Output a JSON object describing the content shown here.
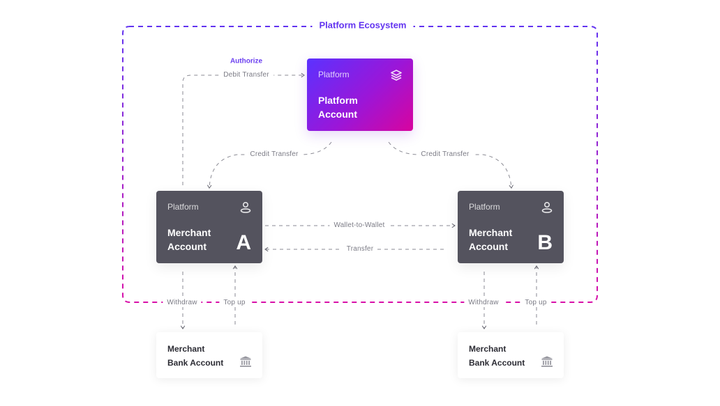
{
  "ecosystem": {
    "title": "Platform Ecosystem",
    "border_colors": [
      "#6233f0",
      "#d80fa8"
    ]
  },
  "platform_account": {
    "kicker": "Platform",
    "title_line1": "Platform",
    "title_line2": "Account",
    "icon": "layers-icon",
    "gradient": [
      "#5b32ff",
      "#d8049e"
    ]
  },
  "merchant_a": {
    "kicker": "Platform",
    "title_line1": "Merchant",
    "title_line2": "Account",
    "letter": "A",
    "icon": "user-icon",
    "color": "#54535e"
  },
  "merchant_b": {
    "kicker": "Platform",
    "title_line1": "Merchant",
    "title_line2": "Account",
    "letter": "B",
    "icon": "user-icon",
    "color": "#54535e"
  },
  "bank_a": {
    "title_line1": "Merchant",
    "title_line2": "Bank Account",
    "icon": "bank-icon"
  },
  "bank_b": {
    "title_line1": "Merchant",
    "title_line2": "Bank Account",
    "icon": "bank-icon"
  },
  "flows": {
    "authorize": "Authorize",
    "debit_transfer": "Debit Transfer",
    "credit_transfer_left": "Credit Transfer",
    "credit_transfer_right": "Credit Transfer",
    "wallet_to_wallet": "Wallet-to-Wallet",
    "transfer": "Transfer",
    "withdraw_a": "Withdraw",
    "top_up_a": "Top up",
    "withdraw_b": "Withdraw",
    "top_up_b": "Top up"
  }
}
